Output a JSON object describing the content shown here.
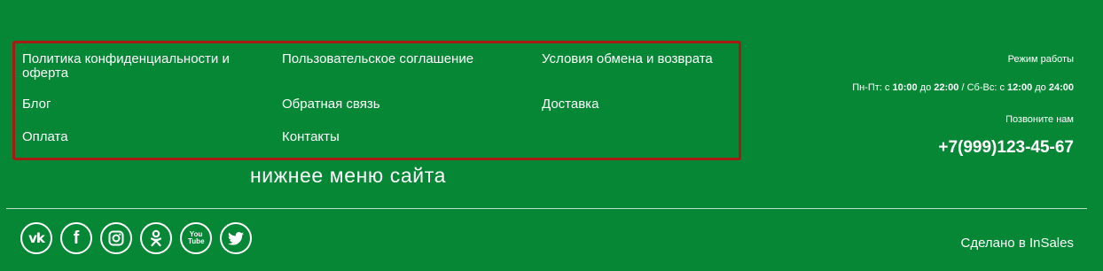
{
  "footer_menu": {
    "items": [
      {
        "label": "Политика конфиденциальности и оферта"
      },
      {
        "label": "Пользовательское соглашение"
      },
      {
        "label": "Условия обмена и возврата"
      },
      {
        "label": "Блог"
      },
      {
        "label": "Обратная связь"
      },
      {
        "label": "Доставка"
      },
      {
        "label": "Оплата"
      },
      {
        "label": "Контакты"
      }
    ],
    "caption": "нижнее меню сайта",
    "highlight_color": "#a61b14"
  },
  "info": {
    "hours_title": "Режим работы",
    "hours": {
      "weekdays_label": "Пн-Пт:",
      "weekdays_from": "с",
      "weekdays_start": "10:00",
      "weekdays_to": "до",
      "weekdays_end": "22:00",
      "separator": "/",
      "weekend_label": "Сб-Вс:",
      "weekend_from": "с",
      "weekend_start": "12:00",
      "weekend_to": "до",
      "weekend_end": "24:00"
    },
    "call_label": "Позвоните нам",
    "phone": "+7(999)123-45-67"
  },
  "socials": [
    {
      "icon": "vk-icon",
      "text": "vk"
    },
    {
      "icon": "facebook-icon",
      "text": "f"
    },
    {
      "icon": "instagram-icon",
      "text": ""
    },
    {
      "icon": "odnoklassniki-icon",
      "text": ""
    },
    {
      "icon": "youtube-icon",
      "text": "You Tube"
    },
    {
      "icon": "twitter-icon",
      "text": ""
    }
  ],
  "credit": "Сделано в InSales",
  "colors": {
    "background": "#058735",
    "text": "#ffffff"
  }
}
